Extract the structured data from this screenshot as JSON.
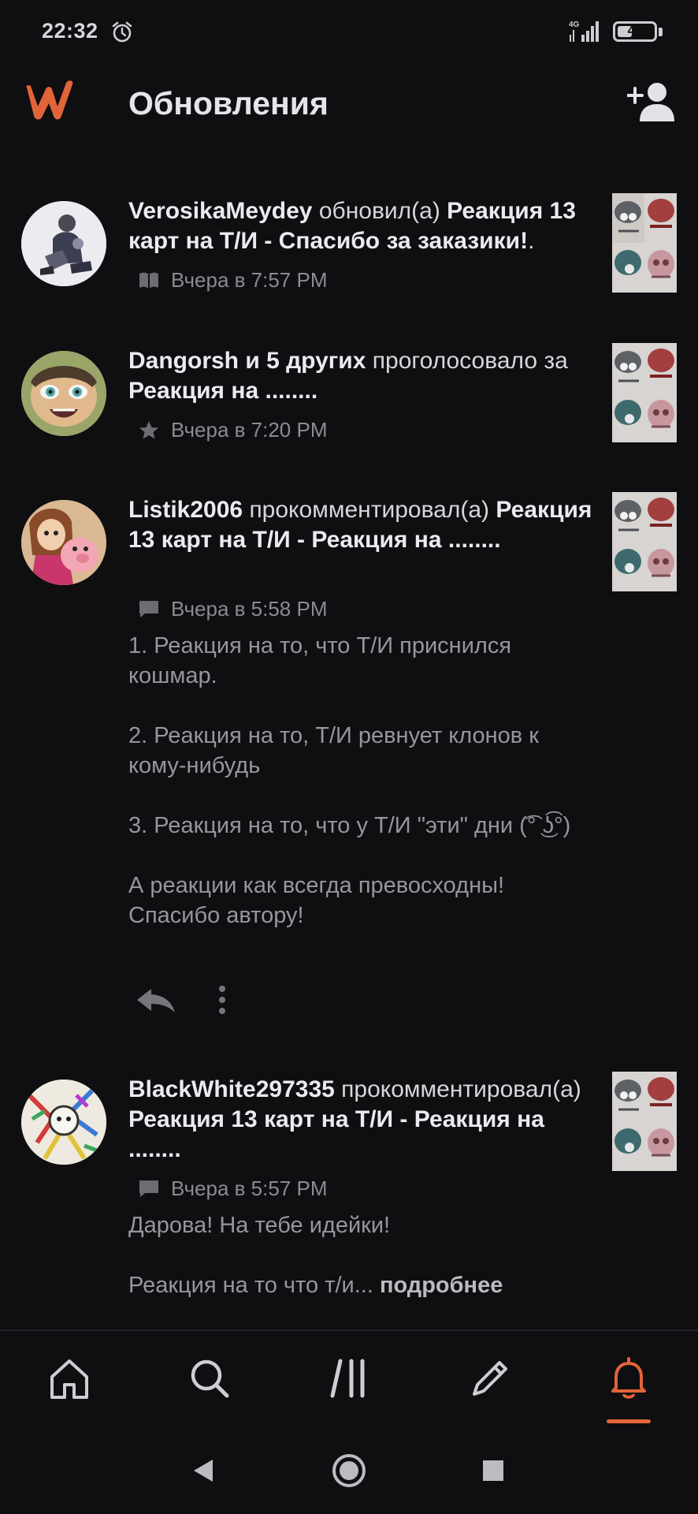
{
  "status_bar": {
    "time": "22:32",
    "network": "4G",
    "battery": "41",
    "battery_level": 0.41,
    "icons": [
      "alarm-icon",
      "signal-icon",
      "battery-icon"
    ]
  },
  "app_bar": {
    "title": "Обновления",
    "logo": "wattpad-logo",
    "action_icon": "add-user-icon"
  },
  "feed": [
    {
      "user": "VerosikaMeydey",
      "action": "обновил(а)",
      "target": "Реакция 13 карт на Т/И - Спасибо за заказики!",
      "target_suffix": ".",
      "meta_icon": "book-icon",
      "time": "Вчера в 7:57 PM"
    },
    {
      "user": "Dangorsh и 5 других",
      "action": "проголосовало за",
      "target": "Реакция на ........",
      "meta_icon": "star-icon",
      "time": "Вчера в 7:20 PM"
    },
    {
      "user": "Listik2006",
      "action": "прокомментировал(а)",
      "target": "Реакция 13 карт на Т/И - Реакция на ........",
      "meta_icon": "comment-icon",
      "time": "Вчера в 5:58 PM",
      "comment": [
        "1. Реакция на то, что Т/И приснился кошмар.",
        "2. Реакция на то, Т/И ревнует клонов к кому-нибудь",
        "3. Реакция на то, что у Т/И \"эти\" дни (͡° ͜ʖ͡°)",
        "А реакции как всегда превосходны! Спасибо автору!"
      ]
    },
    {
      "user": "BlackWhite297335",
      "action": "прокомментировал(а)",
      "target": "Реакция 13 карт на Т/И - Реакция на ........",
      "meta_icon": "comment-icon",
      "time": "Вчера в 5:57 PM",
      "comment": [
        "Дарова! На тебе идейки!"
      ],
      "comment_preview": "Реакция на то что т/и...",
      "read_more": "подробнее"
    }
  ],
  "bottom_nav": {
    "items": [
      "home-icon",
      "search-icon",
      "library-icon",
      "write-icon",
      "notifications-icon"
    ],
    "active": "notifications-icon"
  },
  "system_nav": [
    "back-icon",
    "home-circle-icon",
    "recents-icon"
  ],
  "colors": {
    "background": "#0f0e11",
    "accent": "#e2643a",
    "text_primary": "#eceaee",
    "text_secondary": "#8d8b91"
  }
}
